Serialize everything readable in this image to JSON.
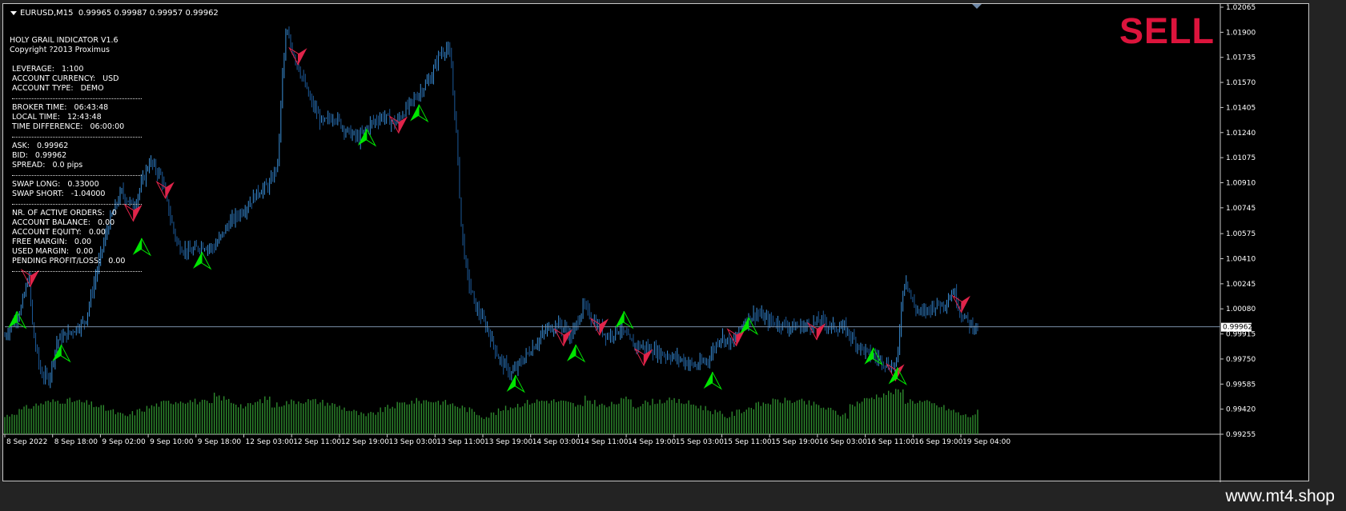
{
  "header": {
    "symbol": "EURUSD,M15",
    "ohlc": "0.99965 0.99987 0.99957 0.99962"
  },
  "signal": "SELL",
  "indicator": {
    "title": "HOLY GRAIL INDICATOR V1.6",
    "copyright": "Copyright ?2013 Proximus",
    "lines": [
      "",
      " LEVERAGE:   1:100",
      " ACCOUNT CURRENCY:   USD",
      " ACCOUNT TYPE:   DEMO",
      "---",
      " BROKER TIME:   06:43:48",
      " LOCAL TIME:   12:43:48",
      " TIME DIFFERENCE:   06:00:00",
      "---",
      " ASK:   0.99962",
      " BID:   0.99962",
      " SPREAD:   0.0 pips",
      "---",
      " SWAP LONG:   0.33000",
      " SWAP SHORT:   -1.04000",
      "---",
      " NR. OF ACTIVE ORDERS:   0",
      " ACCOUNT BALANCE:   0.00",
      " ACCOUNT EQUITY:   0.00",
      " FREE MARGIN:   0.00",
      " USED MARGIN:   0.00",
      " PENDING PROFIT/LOSS:   0.00",
      "---"
    ]
  },
  "chart_data": {
    "type": "candlestick",
    "symbol": "EURUSD",
    "timeframe": "M15",
    "current_price": 0.99962,
    "ylim": [
      0.99255,
      1.02065
    ],
    "y_ticks": [
      "1.02065",
      "1.01900",
      "1.01735",
      "1.01570",
      "1.01405",
      "1.01240",
      "1.01075",
      "1.00910",
      "1.00745",
      "1.00575",
      "1.00410",
      "1.00245",
      "1.00080",
      "0.99915",
      "0.99750",
      "0.99585",
      "0.99420",
      "0.99255"
    ],
    "x_ticks": [
      "8 Sep 2022",
      "8 Sep 18:00",
      "9 Sep 02:00",
      "9 Sep 10:00",
      "9 Sep 18:00",
      "12 Sep 03:00",
      "12 Sep 11:00",
      "12 Sep 19:00",
      "13 Sep 03:00",
      "13 Sep 11:00",
      "13 Sep 19:00",
      "14 Sep 03:00",
      "14 Sep 11:00",
      "14 Sep 19:00",
      "15 Sep 03:00",
      "15 Sep 11:00",
      "15 Sep 19:00",
      "16 Sep 03:00",
      "16 Sep 11:00",
      "16 Sep 19:00",
      "19 Sep 04:00"
    ],
    "price_path": [
      [
        0,
        0.999
      ],
      [
        0.02,
        1.0008
      ],
      [
        0.03,
        1.003
      ],
      [
        0.035,
        0.9993
      ],
      [
        0.045,
        0.9965
      ],
      [
        0.055,
        0.9962
      ],
      [
        0.065,
        0.9987
      ],
      [
        0.08,
        0.9992
      ],
      [
        0.1,
        1.0
      ],
      [
        0.12,
        1.0045
      ],
      [
        0.13,
        1.0065
      ],
      [
        0.145,
        1.0085
      ],
      [
        0.16,
        1.0075
      ],
      [
        0.17,
        1.009
      ],
      [
        0.18,
        1.0105
      ],
      [
        0.195,
        1.0095
      ],
      [
        0.205,
        1.007
      ],
      [
        0.215,
        1.005
      ],
      [
        0.23,
        1.0045
      ],
      [
        0.245,
        1.005
      ],
      [
        0.26,
        1.0048
      ],
      [
        0.28,
        1.0065
      ],
      [
        0.3,
        1.0075
      ],
      [
        0.315,
        1.0085
      ],
      [
        0.33,
        1.009
      ],
      [
        0.34,
        1.0105
      ],
      [
        0.345,
        1.016
      ],
      [
        0.35,
        1.019
      ],
      [
        0.36,
        1.0175
      ],
      [
        0.37,
        1.016
      ],
      [
        0.38,
        1.0145
      ],
      [
        0.395,
        1.013
      ],
      [
        0.41,
        1.0135
      ],
      [
        0.425,
        1.0125
      ],
      [
        0.44,
        1.012
      ],
      [
        0.455,
        1.013
      ],
      [
        0.47,
        1.0135
      ],
      [
        0.485,
        1.013
      ],
      [
        0.5,
        1.014
      ],
      [
        0.515,
        1.015
      ],
      [
        0.53,
        1.016
      ],
      [
        0.54,
        1.0175
      ],
      [
        0.55,
        1.018
      ],
      [
        0.555,
        1.017
      ],
      [
        0.562,
        1.012
      ],
      [
        0.568,
        1.006
      ],
      [
        0.575,
        1.003
      ],
      [
        0.585,
        1.001
      ],
      [
        0.6,
        0.9995
      ],
      [
        0.615,
        0.9975
      ],
      [
        0.63,
        0.9965
      ],
      [
        0.645,
        0.9975
      ],
      [
        0.66,
        0.9985
      ],
      [
        0.675,
        0.9995
      ],
      [
        0.69,
        0.9998
      ],
      [
        0.705,
        0.999
      ],
      [
        0.72,
        1.001
      ],
      [
        0.735,
        0.9998
      ],
      [
        0.75,
        0.999
      ],
      [
        0.765,
        0.9995
      ],
      [
        0.78,
        0.9985
      ],
      [
        0.8,
        0.9982
      ],
      [
        0.82,
        0.9978
      ],
      [
        0.84,
        0.9975
      ],
      [
        0.86,
        0.997
      ],
      [
        0.875,
        0.9975
      ],
      [
        0.89,
        0.999
      ],
      [
        0.905,
        0.9985
      ],
      [
        0.92,
        1.0
      ],
      [
        0.935,
        1.0005
      ],
      [
        0.95,
        1.0
      ],
      [
        0.965,
        0.9998
      ],
      [
        0.98,
        0.9996
      ],
      [
        1.0,
        0.9997
      ],
      [
        1.015,
        1.0
      ],
      [
        1.03,
        0.9996
      ],
      [
        1.045,
        0.9995
      ],
      [
        1.06,
        0.9985
      ],
      [
        1.075,
        0.9978
      ],
      [
        1.09,
        0.9975
      ],
      [
        1.1,
        0.997
      ],
      [
        1.11,
        0.9972
      ],
      [
        1.115,
        1.001
      ],
      [
        1.12,
        1.003
      ],
      [
        1.13,
        1.001
      ],
      [
        1.14,
        1.0005
      ],
      [
        1.155,
        1.001
      ],
      [
        1.17,
        1.0012
      ],
      [
        1.18,
        1.002
      ],
      [
        1.19,
        1.0005
      ],
      [
        1.2,
        0.9998
      ],
      [
        1.21,
        0.9996
      ]
    ],
    "signals": [
      {
        "dir": "buy",
        "i": 0.015,
        "p": 0.9997
      },
      {
        "dir": "sell",
        "i": 0.032,
        "p": 1.0032
      },
      {
        "dir": "buy",
        "i": 0.07,
        "p": 0.9975
      },
      {
        "dir": "sell",
        "i": 0.16,
        "p": 1.0075
      },
      {
        "dir": "buy",
        "i": 0.17,
        "p": 1.0045
      },
      {
        "dir": "sell",
        "i": 0.2,
        "p": 1.009
      },
      {
        "dir": "buy",
        "i": 0.245,
        "p": 1.0036
      },
      {
        "dir": "sell",
        "i": 0.365,
        "p": 1.0178
      },
      {
        "dir": "buy",
        "i": 0.45,
        "p": 1.0117
      },
      {
        "dir": "sell",
        "i": 0.49,
        "p": 1.0133
      },
      {
        "dir": "buy",
        "i": 0.515,
        "p": 1.0133
      },
      {
        "dir": "buy",
        "i": 0.635,
        "p": 0.9955
      },
      {
        "dir": "sell",
        "i": 0.695,
        "p": 0.9993
      },
      {
        "dir": "buy",
        "i": 0.71,
        "p": 0.9975
      },
      {
        "dir": "sell",
        "i": 0.74,
        "p": 1.0
      },
      {
        "dir": "buy",
        "i": 0.77,
        "p": 0.9997
      },
      {
        "dir": "sell",
        "i": 0.795,
        "p": 0.998
      },
      {
        "dir": "buy",
        "i": 0.88,
        "p": 0.9957
      },
      {
        "dir": "sell",
        "i": 0.91,
        "p": 0.9993
      },
      {
        "dir": "buy",
        "i": 0.925,
        "p": 0.9993
      },
      {
        "dir": "sell",
        "i": 1.01,
        "p": 0.9997
      },
      {
        "dir": "buy",
        "i": 1.08,
        "p": 0.9973
      },
      {
        "dir": "sell",
        "i": 1.108,
        "p": 0.997
      },
      {
        "dir": "buy",
        "i": 1.11,
        "p": 0.996
      },
      {
        "dir": "sell",
        "i": 1.19,
        "p": 1.0015
      }
    ],
    "colors": {
      "up_candle": "#3a8fd8",
      "down_candle": "#1c5a9a",
      "volume": "#2e8b2e",
      "grid": "none",
      "buy": "#00e600",
      "sell": "#e0244a",
      "price_line": "#7a8fa8"
    }
  },
  "watermark": "www.mt4.shop"
}
